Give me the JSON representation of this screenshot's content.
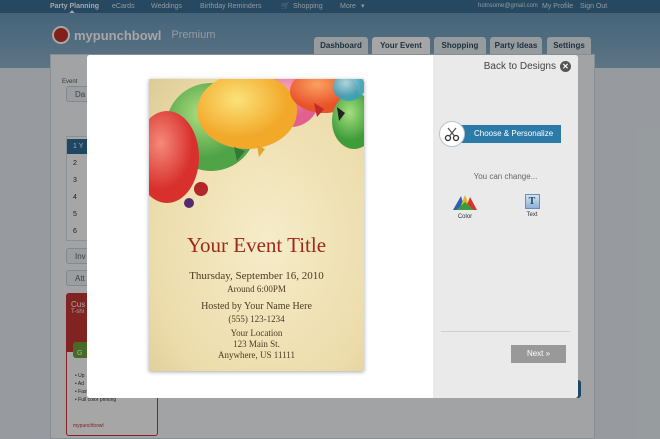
{
  "topnav": {
    "items": [
      "Party Planning",
      "eCards",
      "Weddings",
      "Birthday Reminders",
      "Shopping",
      "More"
    ],
    "email": "hotnsome@gmail.com",
    "my_profile": "My Profile",
    "sign_out": "Sign Out"
  },
  "brand": {
    "logo": "mypunchbowl",
    "premium": "Premium"
  },
  "tabs": [
    "Dashboard",
    "Your Event",
    "Shopping",
    "Party Ideas",
    "Settings"
  ],
  "active_tab": "Your Event",
  "left_panel": {
    "event_label": "Event",
    "box1": "Da",
    "steps": [
      "1 Y",
      "2",
      "3",
      "4",
      "5",
      "6"
    ],
    "box2": "Inv",
    "box3": "Att"
  },
  "promo": {
    "title": "Cus",
    "subtitle": "T-shi",
    "button": "G",
    "list": [
      "Up",
      "Ad",
      "Fast shipping",
      "Full color printing"
    ],
    "footer": "mypunchbowl"
  },
  "modal": {
    "back_label": "Back to Designs",
    "invitation": {
      "title": "Your Event Title",
      "date": "Thursday, September 16, 2010",
      "time": "Around 6:00PM",
      "host": "Hosted by Your Name Here",
      "phone": "(555) 123-1234",
      "location": "Your Location",
      "street": "123 Main St.",
      "city": "Anywhere, US 11111"
    },
    "choose_label": "Choose & Personalize",
    "change_label": "You can change...",
    "color_label": "Color",
    "text_label": "Text",
    "text_icon_glyph": "T",
    "next_label": "Next »"
  },
  "colors": {
    "nav": "#3b6f95",
    "accent_blue": "#2c7aa8",
    "title_red": "#9b2a1c",
    "next_gray": "#999999"
  },
  "icons": [
    "close-icon",
    "scissors-icon",
    "color-swatch-icon",
    "text-icon",
    "cart-icon"
  ]
}
